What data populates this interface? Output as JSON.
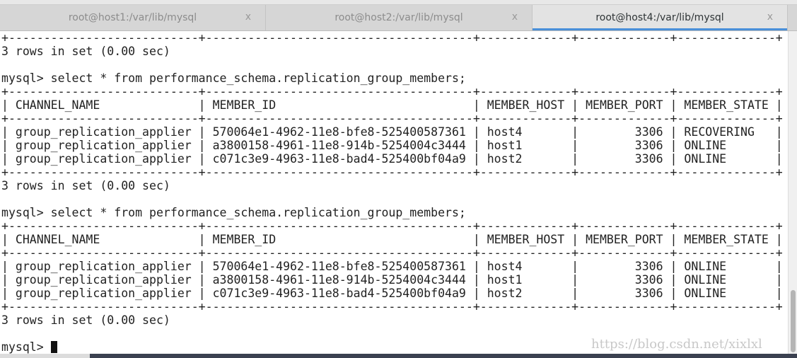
{
  "tabs": [
    {
      "title": "root@host1:/var/lib/mysql",
      "close": "x",
      "active": false
    },
    {
      "title": "root@host2:/var/lib/mysql",
      "close": "x",
      "active": false
    },
    {
      "title": "root@host4:/var/lib/mysql",
      "close": "x",
      "active": true
    }
  ],
  "terminal": {
    "lines": [
      "+---------------------------+--------------------------------------+-------------+-------------+--------------+",
      "3 rows in set (0.00 sec)",
      "",
      "mysql> select * from performance_schema.replication_group_members;",
      "+---------------------------+--------------------------------------+-------------+-------------+--------------+",
      "| CHANNEL_NAME              | MEMBER_ID                            | MEMBER_HOST | MEMBER_PORT | MEMBER_STATE |",
      "+---------------------------+--------------------------------------+-------------+-------------+--------------+",
      "| group_replication_applier | 570064e1-4962-11e8-bfe8-525400587361 | host4       |        3306 | RECOVERING   |",
      "| group_replication_applier | a3800158-4961-11e8-914b-5254004c3444 | host1       |        3306 | ONLINE       |",
      "| group_replication_applier | c071c3e9-4963-11e8-bad4-525400bf04a9 | host2       |        3306 | ONLINE       |",
      "+---------------------------+--------------------------------------+-------------+-------------+--------------+",
      "3 rows in set (0.00 sec)",
      "",
      "mysql> select * from performance_schema.replication_group_members;",
      "+---------------------------+--------------------------------------+-------------+-------------+--------------+",
      "| CHANNEL_NAME              | MEMBER_ID                            | MEMBER_HOST | MEMBER_PORT | MEMBER_STATE |",
      "+---------------------------+--------------------------------------+-------------+-------------+--------------+",
      "| group_replication_applier | 570064e1-4962-11e8-bfe8-525400587361 | host4       |        3306 | ONLINE       |",
      "| group_replication_applier | a3800158-4961-11e8-914b-5254004c3444 | host1       |        3306 | ONLINE       |",
      "| group_replication_applier | c071c3e9-4963-11e8-bad4-525400bf04a9 | host2       |        3306 | ONLINE       |",
      "+---------------------------+--------------------------------------+-------------+-------------+--------------+",
      "3 rows in set (0.00 sec)",
      ""
    ],
    "prompt": "mysql> "
  },
  "watermark": "https://blog.csdn.net/xixlxl",
  "colors": {
    "accent": "#4a90d9"
  }
}
